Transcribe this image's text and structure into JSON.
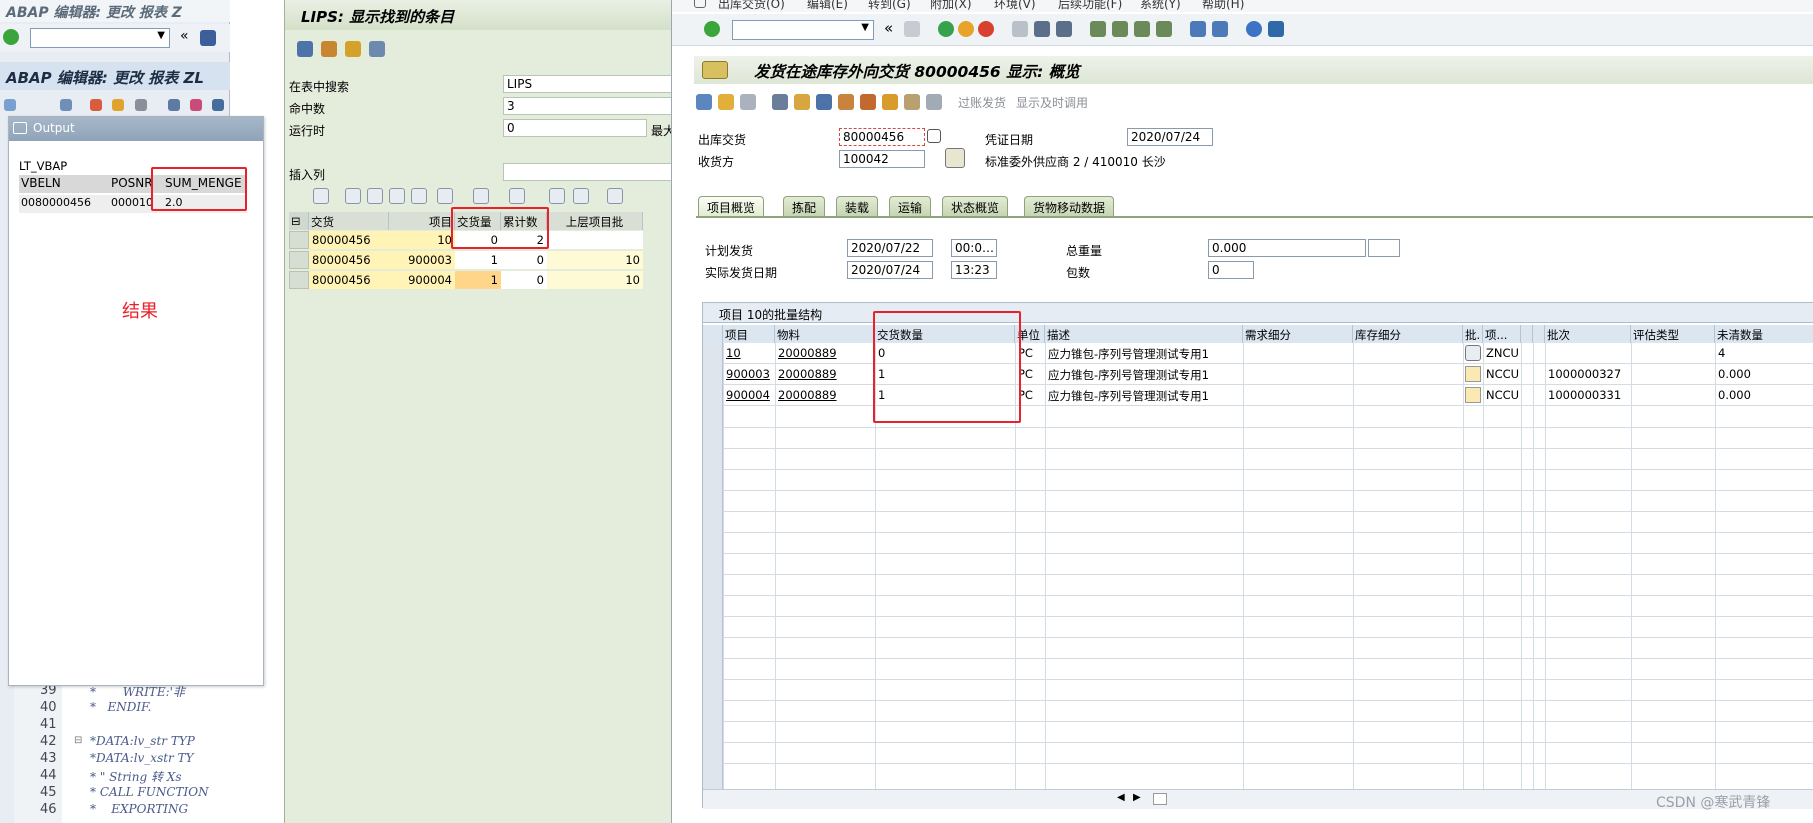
{
  "left_editor": {
    "title1": "ABAP 编辑器: 更改 报表 Z",
    "title2": "ABAP 编辑器: 更改 报表 ZL",
    "code_lines": [
      {
        "no": "39",
        "text": "*       WRITE:'非"
      },
      {
        "no": "40",
        "text": "*   ENDIF."
      },
      {
        "no": "41",
        "text": ""
      },
      {
        "no": "42",
        "text": "*DATA:lv_str TYP"
      },
      {
        "no": "43",
        "text": "*DATA:lv_xstr TY"
      },
      {
        "no": "44",
        "text": "* \" String 转 Xs"
      },
      {
        "no": "45",
        "text": "* CALL FUNCTION"
      },
      {
        "no": "46",
        "text": "*    EXPORTING"
      }
    ]
  },
  "output_window": {
    "title": "Output",
    "table_name": "LT_VBAP",
    "headers": [
      "VBELN",
      "POSNR",
      "SUM_MENGE"
    ],
    "row": [
      "0080000456",
      "000010",
      "2.0"
    ],
    "result_label": "结果"
  },
  "lips": {
    "title": "LIPS: 显示找到的条目",
    "fields": [
      {
        "label": "在表中搜索",
        "value": "LIPS"
      },
      {
        "label": "命中数",
        "value": "3"
      },
      {
        "label": "运行时",
        "value": "0"
      }
    ],
    "max_label": "最大",
    "insert_col_label": "插入列",
    "headers": [
      "交货",
      "项目",
      "交货量",
      "累计数",
      "上层项目批"
    ],
    "rows": [
      [
        "80000456",
        "10",
        "0",
        "2",
        ""
      ],
      [
        "80000456",
        "900003",
        "1",
        "0",
        "10"
      ],
      [
        "80000456",
        "900004",
        "1",
        "0",
        "10"
      ]
    ]
  },
  "sap": {
    "menu": [
      "出库交货(O)",
      "编辑(E)",
      "转到(G)",
      "附加(X)",
      "环境(V)",
      "后续功能(F)",
      "系统(Y)",
      "帮助(H)"
    ],
    "title": "发货在途库存外向交货 80000456 显示: 概览",
    "toolbar_text": [
      "过账发货",
      "显示及时调用"
    ],
    "outbound_label": "出库交货",
    "outbound_value": "80000456",
    "doc_date_label": "凭证日期",
    "doc_date_value": "2020/07/24",
    "ship_to_label": "收货方",
    "ship_to_value": "100042",
    "ship_to_desc": "标准委外供应商 2 / 410010 长沙",
    "tabs": [
      "项目概览",
      "拣配",
      "装载",
      "运输",
      "状态概览",
      "货物移动数据"
    ],
    "planned_gi_label": "计划发货",
    "planned_gi_date": "2020/07/22",
    "planned_gi_time": "00:0…",
    "actual_gi_label": "实际发货日期",
    "actual_gi_date": "2020/07/24",
    "actual_gi_time": "13:23",
    "total_weight_label": "总重量",
    "total_weight_value": "0.000",
    "packages_label": "包数",
    "packages_value": "0",
    "grid_title": "项目 10的批量结构",
    "grid_headers": [
      "项目",
      "物料",
      "交货数量",
      "单位",
      "描述",
      "需求细分",
      "库存细分",
      "批.",
      "项...",
      "批次",
      "评估类型",
      "未清数量"
    ],
    "grid_rows": [
      {
        "item": "10",
        "material": "20000889",
        "qty": "0",
        "unit": "PC",
        "desc": "应力锥包-序列号管理测试专用1",
        "cat": "ZNCU",
        "batch": "",
        "open": "4"
      },
      {
        "item": "900003",
        "material": "20000889",
        "qty": "1",
        "unit": "PC",
        "desc": "应力锥包-序列号管理测试专用1",
        "cat": "NCCU",
        "batch": "1000000327",
        "open": "0.000"
      },
      {
        "item": "900004",
        "material": "20000889",
        "qty": "1",
        "unit": "PC",
        "desc": "应力锥包-序列号管理测试专用1",
        "cat": "NCCU",
        "batch": "1000000331",
        "open": "0.000"
      }
    ]
  },
  "watermark": "CSDN @寒武青锋"
}
